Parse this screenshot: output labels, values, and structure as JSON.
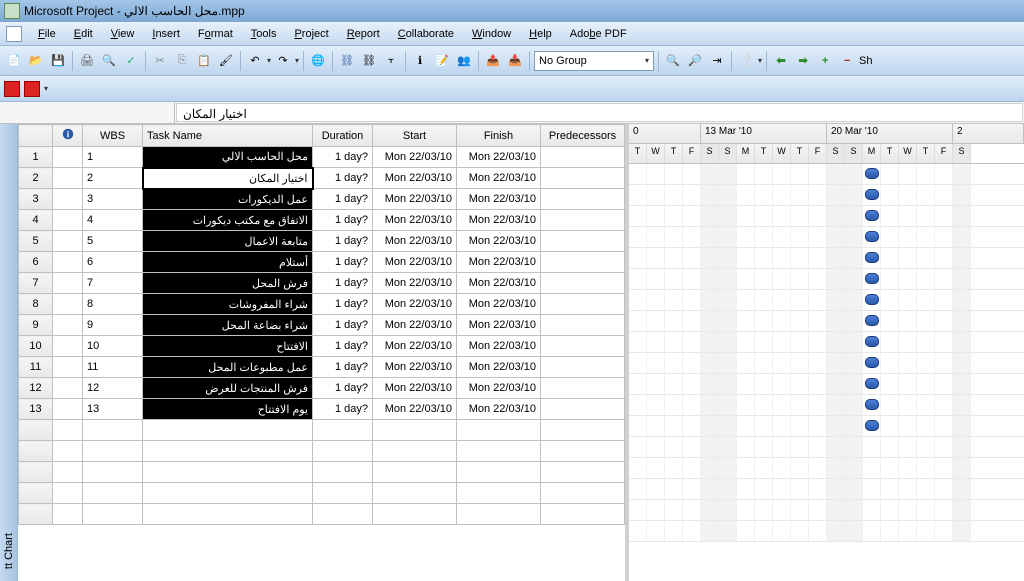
{
  "title": "Microsoft Project - محل الحاسب الالي.mpp",
  "menu": {
    "file": "File",
    "edit": "Edit",
    "view": "View",
    "insert": "Insert",
    "format": "Format",
    "tools": "Tools",
    "project": "Project",
    "report": "Report",
    "collaborate": "Collaborate",
    "window": "Window",
    "help": "Help",
    "adobe": "Adobe PDF"
  },
  "toolbar": {
    "group_combo": "No Group",
    "show_label": "Sh"
  },
  "formula": {
    "value": "اختيار المكان"
  },
  "columns": {
    "wbs": "WBS",
    "task_name": "Task Name",
    "duration": "Duration",
    "start": "Start",
    "finish": "Finish",
    "predecessors": "Predecessors"
  },
  "gantt_header": {
    "partial1": "0",
    "week1": "13 Mar '10",
    "week2": "20 Mar '10",
    "partial2": "2",
    "days1": [
      "T",
      "W",
      "T",
      "F"
    ],
    "days2": [
      "S",
      "S",
      "M",
      "T",
      "W",
      "T",
      "F"
    ],
    "days3": [
      "S",
      "S",
      "M",
      "T",
      "W",
      "T",
      "F"
    ],
    "days4": [
      "S"
    ]
  },
  "sidebar_tab": "tt Chart",
  "tasks": [
    {
      "row": "1",
      "wbs": "1",
      "name": "محل الحاسب الالي",
      "selected": false,
      "duration": "1 day?",
      "start": "Mon 22/03/10",
      "finish": "Mon 22/03/10"
    },
    {
      "row": "2",
      "wbs": "2",
      "name": "اختيار المكان",
      "selected": true,
      "duration": "1 day?",
      "start": "Mon 22/03/10",
      "finish": "Mon 22/03/10"
    },
    {
      "row": "3",
      "wbs": "3",
      "name": "عمل الديكورات",
      "selected": false,
      "duration": "1 day?",
      "start": "Mon 22/03/10",
      "finish": "Mon 22/03/10"
    },
    {
      "row": "4",
      "wbs": "4",
      "name": "الاتفاق مع مكتب ديكورات",
      "selected": false,
      "duration": "1 day?",
      "start": "Mon 22/03/10",
      "finish": "Mon 22/03/10"
    },
    {
      "row": "5",
      "wbs": "5",
      "name": "متابعة الاعمال",
      "selected": false,
      "duration": "1 day?",
      "start": "Mon 22/03/10",
      "finish": "Mon 22/03/10"
    },
    {
      "row": "6",
      "wbs": "6",
      "name": "أستلام",
      "selected": false,
      "duration": "1 day?",
      "start": "Mon 22/03/10",
      "finish": "Mon 22/03/10"
    },
    {
      "row": "7",
      "wbs": "7",
      "name": "فرش المحل",
      "selected": false,
      "duration": "1 day?",
      "start": "Mon 22/03/10",
      "finish": "Mon 22/03/10"
    },
    {
      "row": "8",
      "wbs": "8",
      "name": "شراء المفروشات",
      "selected": false,
      "duration": "1 day?",
      "start": "Mon 22/03/10",
      "finish": "Mon 22/03/10"
    },
    {
      "row": "9",
      "wbs": "9",
      "name": "شراء بضاعة المحل",
      "selected": false,
      "duration": "1 day?",
      "start": "Mon 22/03/10",
      "finish": "Mon 22/03/10"
    },
    {
      "row": "10",
      "wbs": "10",
      "name": "الافتتاح",
      "selected": false,
      "duration": "1 day?",
      "start": "Mon 22/03/10",
      "finish": "Mon 22/03/10"
    },
    {
      "row": "11",
      "wbs": "11",
      "name": "عمل مطبوعات المحل",
      "selected": false,
      "duration": "1 day?",
      "start": "Mon 22/03/10",
      "finish": "Mon 22/03/10"
    },
    {
      "row": "12",
      "wbs": "12",
      "name": "فرش المنتجات للعرض",
      "selected": false,
      "duration": "1 day?",
      "start": "Mon 22/03/10",
      "finish": "Mon 22/03/10"
    },
    {
      "row": "13",
      "wbs": "13",
      "name": "يوم الافتتاح",
      "selected": false,
      "duration": "1 day?",
      "start": "Mon 22/03/10",
      "finish": "Mon 22/03/10"
    }
  ]
}
